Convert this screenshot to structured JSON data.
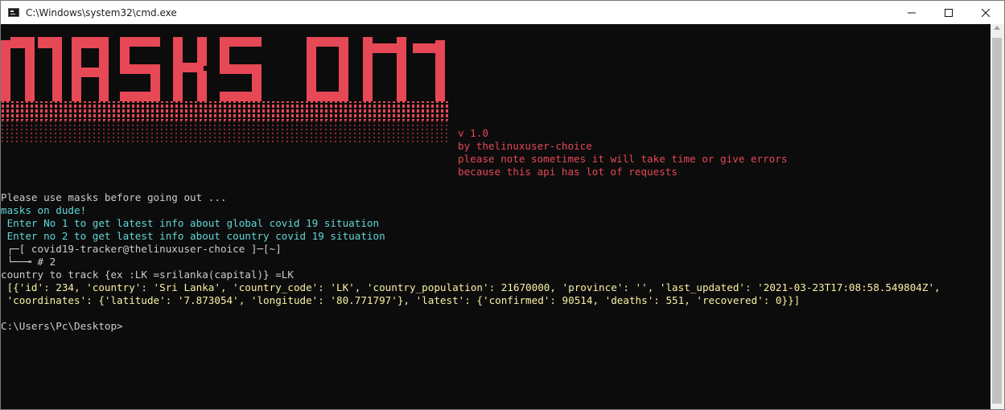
{
  "window": {
    "title": "C:\\Windows\\system32\\cmd.exe",
    "icon": "cmd-icon",
    "controls": {
      "minimize": "minimize-icon",
      "maximize": "maximize-icon",
      "close": "close-icon"
    }
  },
  "banner": {
    "art_text": "MASKS ON",
    "color": "#e74856"
  },
  "info": {
    "version": "v 1.0",
    "author": "by thelinuxuser-choice",
    "note1": "please note sometimes it will take time or give errors",
    "note2": "because this api has lot of requests"
  },
  "console": {
    "l1": "Please use masks before going out ...",
    "l2": "masks on dude!",
    "l3": " Enter No 1 to get latest info about global covid 19 situation",
    "l4": " Enter no 2 to get latest info about country covid 19 situation",
    "l5": " ┌─[ covid19-tracker@thelinuxuser-choice ]─[~]",
    "l6": " └──╼ # 2",
    "l7": "country to track {ex :LK =srilanka(capital)} =LK",
    "l8": " [{'id': 234, 'country': 'Sri Lanka', 'country_code': 'LK', 'country_population': 21670000, 'province': '', 'last_updated': '2021-03-23T17:08:58.549804Z',",
    "l9": " 'coordinates': {'latitude': '7.873054', 'longitude': '80.771797'}, 'latest': {'confirmed': 90514, 'deaths': 551, 'recovered': 0}}]",
    "l10": "C:\\Users\\Pc\\Desktop>"
  },
  "colors": {
    "background": "#0c0c0c",
    "red": "#e74856",
    "cyan": "#61d6d6",
    "yellow": "#f9f1a5",
    "gray": "#cccccc"
  }
}
